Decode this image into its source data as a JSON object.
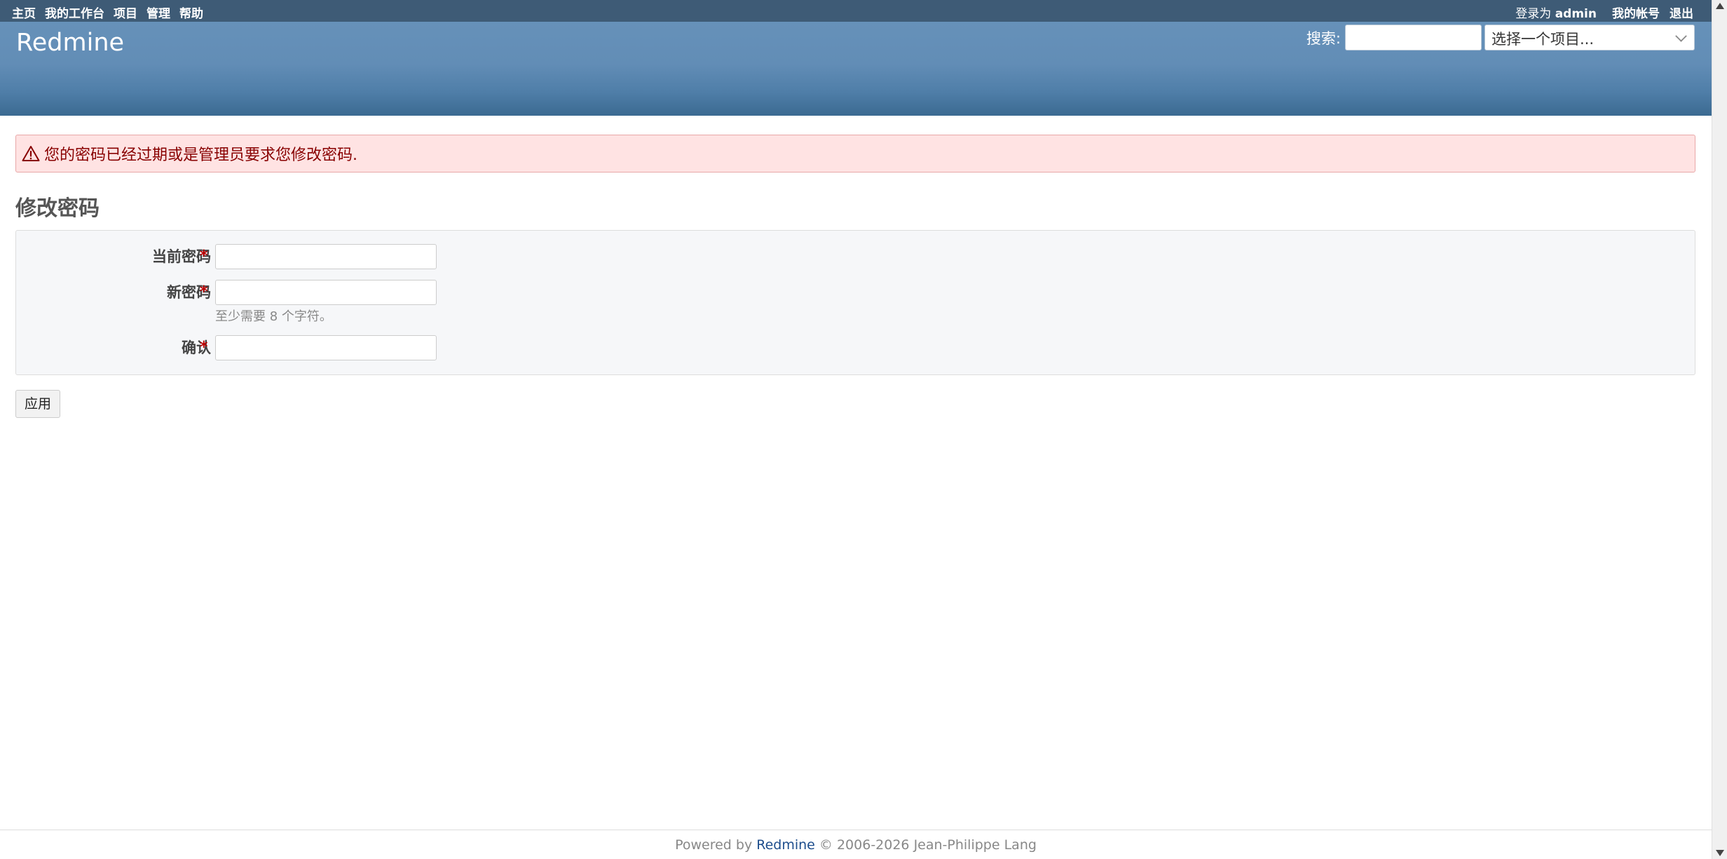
{
  "top_menu": {
    "items": [
      "主页",
      "我的工作台",
      "项目",
      "管理",
      "帮助"
    ],
    "logged_as_prefix": "登录为",
    "logged_as_user": "admin",
    "account_items": [
      "我的帐号",
      "退出"
    ]
  },
  "header": {
    "site_title": "Redmine",
    "search_label": "搜索:",
    "search_value": "",
    "project_jump": "选择一个项目..."
  },
  "flash": {
    "icon": "warning-icon",
    "message": "您的密码已经过期或是管理员要求您修改密码."
  },
  "page": {
    "title": "修改密码"
  },
  "form": {
    "fields": [
      {
        "label": "当前密码",
        "required": "*",
        "value": ""
      },
      {
        "label": "新密码",
        "required": "*",
        "value": "",
        "hint": "至少需要 8 个字符。"
      },
      {
        "label": "确认",
        "required": "*",
        "value": ""
      }
    ],
    "submit_label": "应用"
  },
  "footer": {
    "prefix": "Powered by",
    "link": "Redmine",
    "suffix": "© 2006-2026 Jean-Philippe Lang"
  },
  "colors": {
    "top_menu_bg": "#3e5b76",
    "header_bg": "#628db6",
    "flash_bg": "#ffe3e3",
    "flash_text": "#880000",
    "required_mark": "#bb0000",
    "link": "#1d4d8c"
  }
}
